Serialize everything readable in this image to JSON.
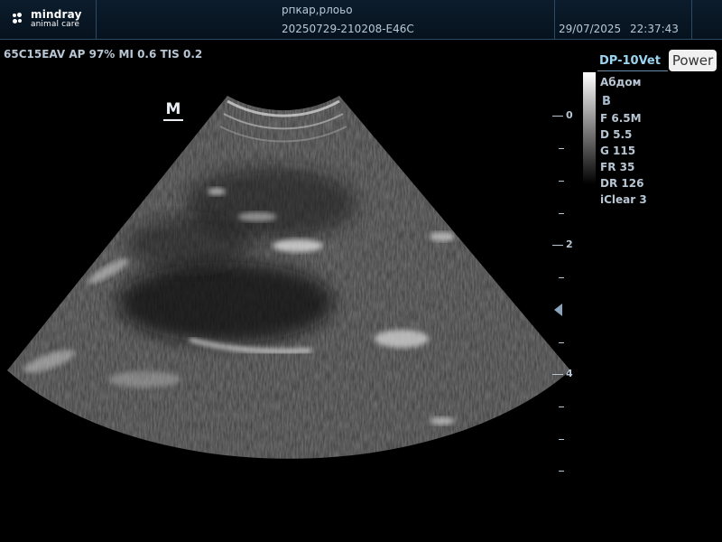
{
  "header": {
    "brand": "mindray",
    "brand_sub": "animal care",
    "patient_name": "рпкар,рлоьо",
    "exam_id": "20250729-210208-E46C",
    "date": "29/07/2025",
    "time": "22:37:43"
  },
  "probe_params": "65C15EAV  AP 97%  MI 0.6 TIS 0.2",
  "orientation_marker": "M",
  "depth_scale": {
    "labels": [
      "0",
      "2",
      "4"
    ],
    "unit": "cm"
  },
  "right_panel": {
    "preset": "DP-10Vet",
    "power_label": "Power",
    "exam_type": "Абдом",
    "mode": "B",
    "params": [
      "F 6.5M",
      "D 5.5",
      "G 115",
      "FR 35",
      "DR 126",
      "iClear 3"
    ]
  },
  "colors": {
    "text": "#b8c6d4",
    "preset": "#9ad4f0",
    "header_border": "#2c4a64"
  },
  "icons": [
    "mindray-logo-icon",
    "focus-marker-icon"
  ]
}
